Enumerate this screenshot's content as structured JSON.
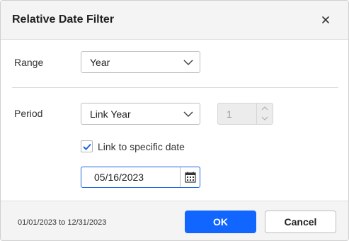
{
  "dialog": {
    "title": "Relative Date Filter",
    "close_icon": "close-icon"
  },
  "range": {
    "label": "Range",
    "value": "Year"
  },
  "period": {
    "label": "Period",
    "value": "Link Year",
    "count": "1"
  },
  "link_specific": {
    "checked": true,
    "label": "Link to specific date"
  },
  "date": {
    "value": "05/16/2023",
    "icon": "calendar-icon"
  },
  "footer": {
    "range_text": "01/01/2023 to 12/31/2023",
    "ok_label": "OK",
    "cancel_label": "Cancel"
  },
  "colors": {
    "accent": "#1166ff",
    "checkmark": "#1f66e5"
  }
}
